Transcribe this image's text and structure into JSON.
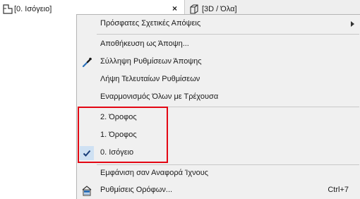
{
  "tabs": {
    "active_label": "[0. Ισόγειο]",
    "close_glyph": "×",
    "inactive_label": "[3D / Όλα]"
  },
  "menu": {
    "items": [
      {
        "label": "Πρόσφατες Σχετικές Απόψεις",
        "has_submenu": true
      },
      {
        "label": "Αποθήκευση ως Άποψη..."
      },
      {
        "label": "Σύλληψη Ρυθμίσεων Άποψης",
        "icon": "eyedropper-icon"
      },
      {
        "label": "Λήψη Τελευταίων Ρυθμίσεων"
      },
      {
        "label": "Εναρμονισμός Όλων με Τρέχουσα"
      },
      {
        "label": "2. Όροφος"
      },
      {
        "label": "1. Όροφος"
      },
      {
        "label": "0. Ισόγειο",
        "checked": true
      },
      {
        "label": "Εμφάνιση σαν Αναφορά Ίχνους"
      },
      {
        "label": "Ρυθμίσεις Ορόφων...",
        "shortcut": "Ctrl+7",
        "icon": "story-settings-icon"
      }
    ]
  },
  "colors": {
    "highlight_border": "#e30613",
    "check_background": "#cfe1f3",
    "menu_background": "#f0f0f0"
  }
}
